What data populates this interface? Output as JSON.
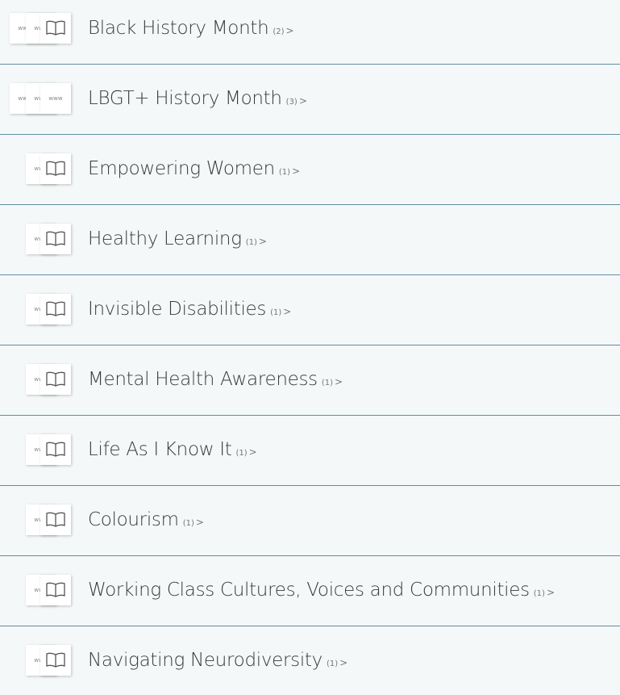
{
  "items": [
    {
      "title": "Black History Month",
      "count": "(2)",
      "chevron": ">",
      "thumb_types": [
        "www",
        "www",
        "book"
      ]
    },
    {
      "title": "LBGT+ History Month",
      "count": "(3)",
      "chevron": ">",
      "thumb_types": [
        "www",
        "www",
        "www"
      ]
    },
    {
      "title": "Empowering Women",
      "count": "(1)",
      "chevron": ">",
      "thumb_types": [
        "www",
        "book"
      ]
    },
    {
      "title": "Healthy Learning",
      "count": "(1)",
      "chevron": ">",
      "thumb_types": [
        "www",
        "book"
      ]
    },
    {
      "title": "Invisible Disabilities",
      "count": "(1)",
      "chevron": ">",
      "thumb_types": [
        "www",
        "book"
      ]
    },
    {
      "title": "Mental Health Awareness",
      "count": "(1)",
      "chevron": ">",
      "thumb_types": [
        "www",
        "book"
      ]
    },
    {
      "title": "Life As I Know It",
      "count": "(1)",
      "chevron": ">",
      "thumb_types": [
        "www",
        "book"
      ]
    },
    {
      "title": "Colourism",
      "count": "(1)",
      "chevron": ">",
      "thumb_types": [
        "www",
        "book"
      ]
    },
    {
      "title": "Working Class Cultures, Voices and Communities",
      "count": "(1)",
      "chevron": ">",
      "thumb_types": [
        "www",
        "book"
      ]
    },
    {
      "title": "Navigating Neurodiversity",
      "count": "(1)",
      "chevron": ">",
      "thumb_types": [
        "www",
        "book"
      ]
    }
  ],
  "icons": {
    "www": "website-thumbnail-icon",
    "book": "book-icon"
  },
  "colors": {
    "divider": "#5f8ea3",
    "background": "#f5f8f8",
    "title_text": "#3a3a3a"
  }
}
